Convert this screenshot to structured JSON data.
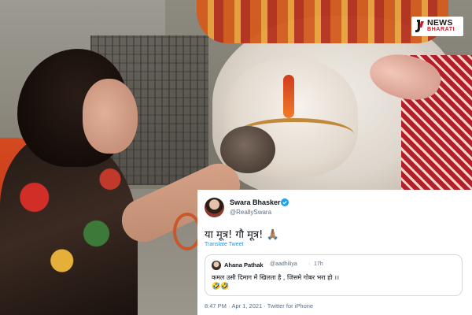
{
  "logo": {
    "line1": "NEWS",
    "line2": "BHARATI",
    "accent_color": "#c81e2b"
  },
  "tweet": {
    "author": {
      "name": "Swara Bhasker",
      "handle": "@ReallySwara",
      "verified": true
    },
    "text": "या मूत्र! गौ मूत्र! 🙏🏽",
    "translate_label": "Translate Tweet",
    "quoted": {
      "name": "Ahana Pathak",
      "handle": "@aadhiliya",
      "dot": "·",
      "time": "17h",
      "text": "कमल उसी दिमाग में खिलता है , जिसमे गोबर भरा हो ।।",
      "emojis": "🤣🤣"
    },
    "meta": {
      "time": "8:47 PM",
      "date": "Apr 1, 2021",
      "source": "Twitter for iPhone",
      "separator": "·"
    }
  },
  "colors": {
    "link": "#1b95e0",
    "verified": "#1da1f2",
    "secondary_text": "#5b7083"
  }
}
